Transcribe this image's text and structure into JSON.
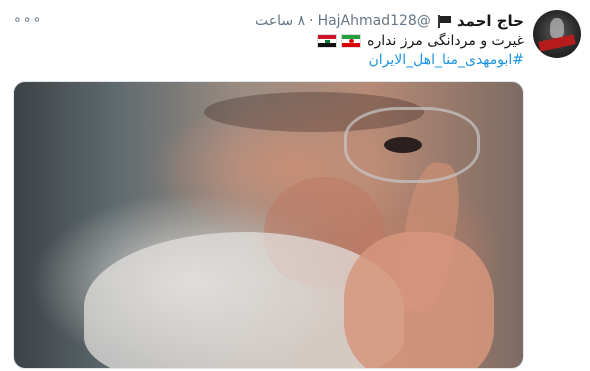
{
  "tweet": {
    "display_name": "حاج احمد",
    "handle": "@HajAhmad128",
    "dot": "·",
    "time": "۸ ساعت",
    "more": "∘∘∘",
    "text": "غیرت و مردانگی مرز نداره",
    "hashtag": "#ابومهدی_منا_اهل_الایران",
    "flags": [
      "iran-flag",
      "iraq-flag"
    ]
  },
  "colors": {
    "link": "#1b95e0",
    "secondary_text": "#657786",
    "primary_text": "#14171a"
  },
  "icons": {
    "name_flag": "black-flag-icon",
    "more": "more-options-icon"
  }
}
